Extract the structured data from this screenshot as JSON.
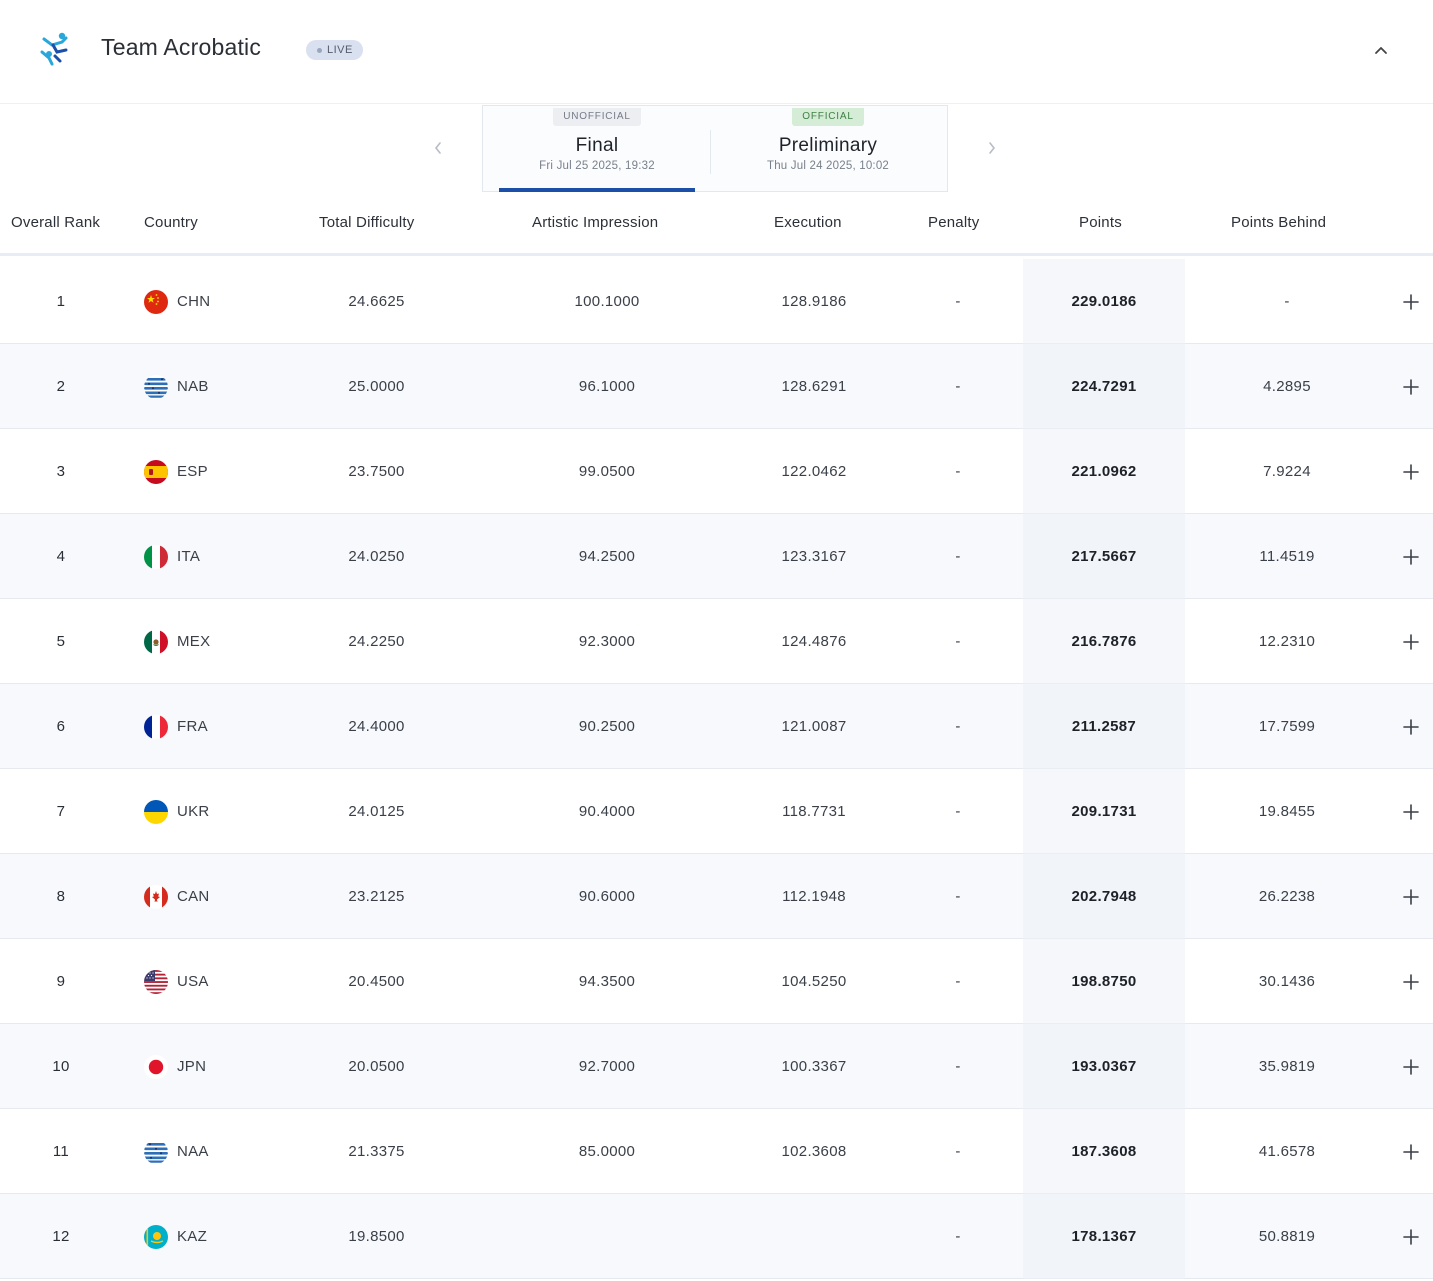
{
  "header": {
    "title": "Team Acrobatic",
    "live_label": "LIVE",
    "icons": {
      "logo": "acrobat-logo-icon",
      "collapse": "chevron-up-icon"
    }
  },
  "phases": {
    "prev_icon": "chevron-left-icon",
    "next_icon": "chevron-right-icon",
    "items": [
      {
        "badge": "UNOFFICIAL",
        "name": "Final",
        "date": "Fri Jul 25 2025, 19:32",
        "active": true
      },
      {
        "badge": "OFFICIAL",
        "name": "Preliminary",
        "date": "Thu Jul 24 2025, 10:02",
        "active": false
      }
    ]
  },
  "table": {
    "columns": {
      "rank": "Overall Rank",
      "country": "Country",
      "difficulty": "Total Difficulty",
      "artistic": "Artistic Impression",
      "execution": "Execution",
      "penalty": "Penalty",
      "points": "Points",
      "behind": "Points Behind"
    },
    "expand_icon": "plus-icon",
    "rows": [
      {
        "rank": "1",
        "country": "CHN",
        "flag_icon": "flag-chn-icon",
        "difficulty": "24.6625",
        "artistic": "100.1000",
        "execution": "128.9186",
        "penalty": "-",
        "points": "229.0186",
        "behind": "-"
      },
      {
        "rank": "2",
        "country": "NAB",
        "flag_icon": "flag-nab-icon",
        "difficulty": "25.0000",
        "artistic": "96.1000",
        "execution": "128.6291",
        "penalty": "-",
        "points": "224.7291",
        "behind": "4.2895"
      },
      {
        "rank": "3",
        "country": "ESP",
        "flag_icon": "flag-esp-icon",
        "difficulty": "23.7500",
        "artistic": "99.0500",
        "execution": "122.0462",
        "penalty": "-",
        "points": "221.0962",
        "behind": "7.9224"
      },
      {
        "rank": "4",
        "country": "ITA",
        "flag_icon": "flag-ita-icon",
        "difficulty": "24.0250",
        "artistic": "94.2500",
        "execution": "123.3167",
        "penalty": "-",
        "points": "217.5667",
        "behind": "11.4519"
      },
      {
        "rank": "5",
        "country": "MEX",
        "flag_icon": "flag-mex-icon",
        "difficulty": "24.2250",
        "artistic": "92.3000",
        "execution": "124.4876",
        "penalty": "-",
        "points": "216.7876",
        "behind": "12.2310"
      },
      {
        "rank": "6",
        "country": "FRA",
        "flag_icon": "flag-fra-icon",
        "difficulty": "24.4000",
        "artistic": "90.2500",
        "execution": "121.0087",
        "penalty": "-",
        "points": "211.2587",
        "behind": "17.7599"
      },
      {
        "rank": "7",
        "country": "UKR",
        "flag_icon": "flag-ukr-icon",
        "difficulty": "24.0125",
        "artistic": "90.4000",
        "execution": "118.7731",
        "penalty": "-",
        "points": "209.1731",
        "behind": "19.8455"
      },
      {
        "rank": "8",
        "country": "CAN",
        "flag_icon": "flag-can-icon",
        "difficulty": "23.2125",
        "artistic": "90.6000",
        "execution": "112.1948",
        "penalty": "-",
        "points": "202.7948",
        "behind": "26.2238"
      },
      {
        "rank": "9",
        "country": "USA",
        "flag_icon": "flag-usa-icon",
        "difficulty": "20.4500",
        "artistic": "94.3500",
        "execution": "104.5250",
        "penalty": "-",
        "points": "198.8750",
        "behind": "30.1436"
      },
      {
        "rank": "10",
        "country": "JPN",
        "flag_icon": "flag-jpn-icon",
        "difficulty": "20.0500",
        "artistic": "92.7000",
        "execution": "100.3367",
        "penalty": "-",
        "points": "193.0367",
        "behind": "35.9819"
      },
      {
        "rank": "11",
        "country": "NAA",
        "flag_icon": "flag-naa-icon",
        "difficulty": "21.3375",
        "artistic": "85.0000",
        "execution": "102.3608",
        "penalty": "-",
        "points": "187.3608",
        "behind": "41.6578"
      },
      {
        "rank": "12",
        "country": "KAZ",
        "flag_icon": "flag-kaz-icon",
        "difficulty": "19.8500",
        "artistic": "",
        "execution": "",
        "penalty": "-",
        "points": "178.1367",
        "behind": "50.8819"
      }
    ]
  }
}
